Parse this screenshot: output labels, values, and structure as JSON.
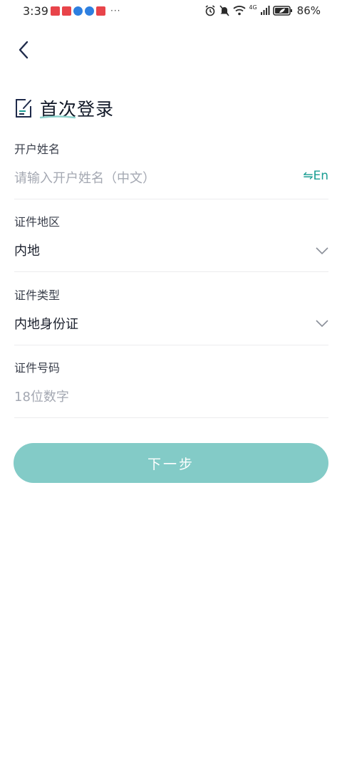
{
  "status_bar": {
    "time": "3:39",
    "network": "4G",
    "battery": "86%"
  },
  "page": {
    "title": "首次登录",
    "back_icon": "chevron-left-icon"
  },
  "form": {
    "name": {
      "label": "开户姓名",
      "placeholder": "请输入开户姓名（中文）",
      "lang_toggle": "⇋En"
    },
    "region": {
      "label": "证件地区",
      "value": "内地"
    },
    "id_type": {
      "label": "证件类型",
      "value": "内地身份证"
    },
    "id_number": {
      "label": "证件号码",
      "placeholder": "18位数字"
    }
  },
  "actions": {
    "next_label": "下一步"
  },
  "colors": {
    "accent": "#1b9e93",
    "button_disabled": "#83cbc7",
    "title_icon": "#1e2a4a"
  }
}
